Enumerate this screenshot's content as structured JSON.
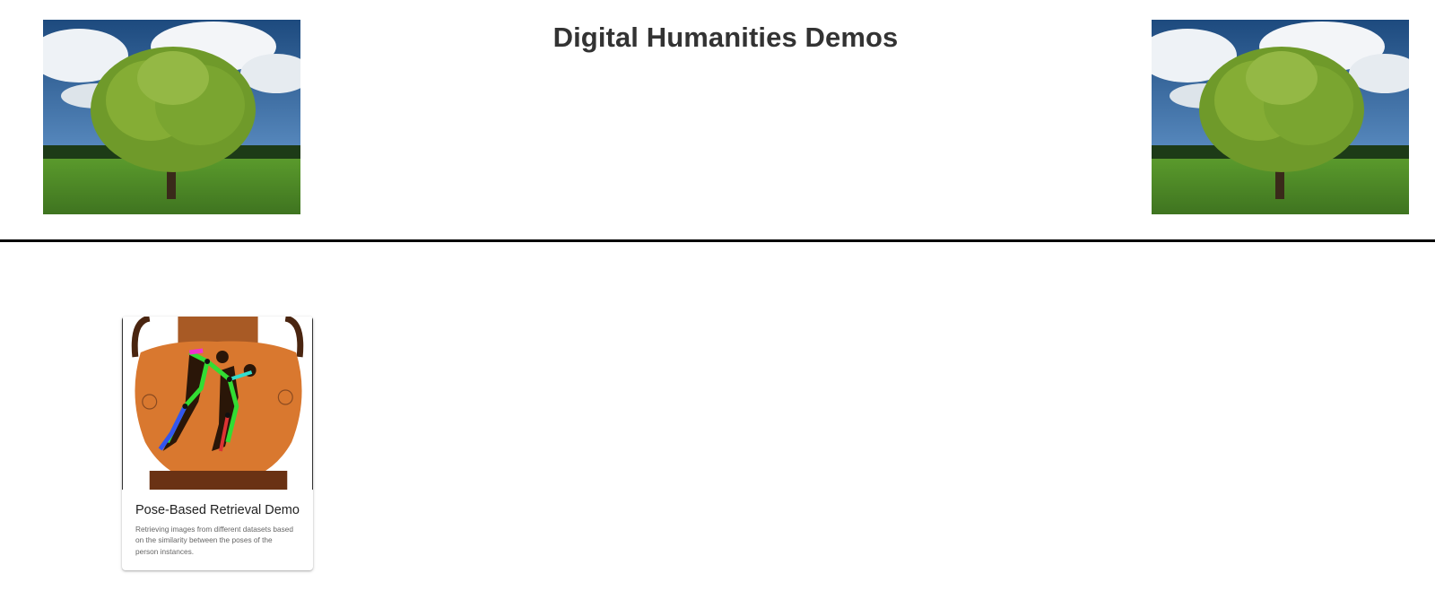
{
  "header": {
    "title": "Digital Humanities Demos",
    "left_image": "tree-landscape-image",
    "right_image": "tree-landscape-image"
  },
  "cards": [
    {
      "image": "greek-vase-pose-image",
      "title": "Pose-Based Retrieval Demo",
      "description": "Retrieving images from different datasets based on the similarity between the poses of the person instances."
    }
  ],
  "colors": {
    "title_text": "#333333",
    "divider": "#000000",
    "card_title": "#222222",
    "card_desc": "#666666",
    "sky": "#2f5f96",
    "grass": "#4e8a2a",
    "vase": "#d9782f"
  }
}
